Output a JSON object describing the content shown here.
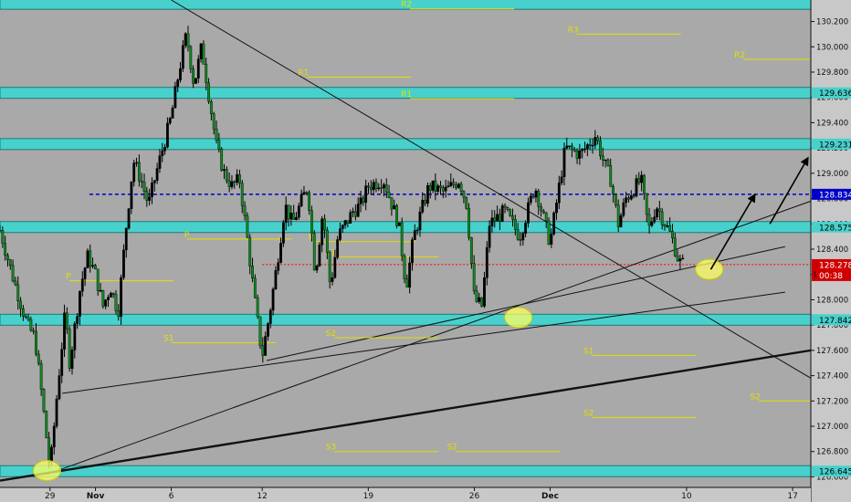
{
  "chart_data": {
    "type": "candlestick",
    "y_axis": {
      "range": [
        126.56,
        130.37
      ],
      "tick_labels": [
        "130.200",
        "130.000",
        "129.800",
        "129.600",
        "129.400",
        "129.200",
        "129.000",
        "128.800",
        "128.600",
        "128.400",
        "128.200",
        "128.000",
        "127.800",
        "127.600",
        "127.400",
        "127.200",
        "127.000",
        "126.800",
        "126.600"
      ],
      "tick_values": [
        130.2,
        130.0,
        129.8,
        129.6,
        129.4,
        129.2,
        129.0,
        128.8,
        128.6,
        128.4,
        128.2,
        128.0,
        127.8,
        127.6,
        127.4,
        127.2,
        127.0,
        126.8,
        126.6
      ]
    },
    "x_axis": {
      "tick_labels": [
        {
          "label": "29",
          "day": 0
        },
        {
          "label": "Nov",
          "day": 3
        },
        {
          "label": "6",
          "day": 8
        },
        {
          "label": "12",
          "day": 14
        },
        {
          "label": "19",
          "day": 21
        },
        {
          "label": "26",
          "day": 28
        },
        {
          "label": "Dec",
          "day": 33
        },
        {
          "label": "10",
          "day": 42
        },
        {
          "label": "17",
          "day": 49
        }
      ],
      "start_date": "Oct 29",
      "days_visible": [
        -3.3,
        50.2
      ]
    },
    "horizontal_zones": [
      {
        "label": "130.200",
        "value": 130.34,
        "flagged": false
      },
      {
        "label": "129.636",
        "value": 129.636,
        "flagged": true
      },
      {
        "label": "129.231",
        "value": 129.231,
        "flagged": true
      },
      {
        "label": "128.575",
        "value": 128.575,
        "flagged": true
      },
      {
        "label": "127.842",
        "value": 127.842,
        "flagged": true
      },
      {
        "label": "126.645",
        "value": 126.645,
        "flagged": true
      }
    ],
    "current_price": {
      "label": "128.278",
      "value": 128.278,
      "countdown": "00:38"
    },
    "dashed_level": {
      "label": "128.834",
      "value": 128.834
    },
    "axis_extra_label": {
      "text": "1",
      "value": 128.2
    },
    "price_path": [
      [
        -3.3,
        128.55
      ],
      [
        -2.5,
        128.2
      ],
      [
        -2,
        128.0
      ],
      [
        -1.5,
        127.8
      ],
      [
        -1,
        127.7
      ],
      [
        -0.5,
        127.2
      ],
      [
        0,
        126.65
      ],
      [
        0.5,
        127.3
      ],
      [
        1,
        127.9
      ],
      [
        1.3,
        127.5
      ],
      [
        2,
        128.1
      ],
      [
        2.5,
        128.35
      ],
      [
        3,
        128.2
      ],
      [
        3.5,
        127.95
      ],
      [
        4,
        128.1
      ],
      [
        4.5,
        127.9
      ],
      [
        5,
        128.55
      ],
      [
        5.5,
        129.1
      ],
      [
        6,
        128.95
      ],
      [
        6.5,
        128.75
      ],
      [
        7,
        129.0
      ],
      [
        8,
        129.45
      ],
      [
        8.5,
        129.8
      ],
      [
        9,
        130.1
      ],
      [
        9.5,
        129.7
      ],
      [
        10,
        130.0
      ],
      [
        10.5,
        129.6
      ],
      [
        11,
        129.2
      ],
      [
        11.5,
        129.0
      ],
      [
        12,
        128.9
      ],
      [
        12.5,
        128.95
      ],
      [
        13,
        128.5
      ],
      [
        13.5,
        128.0
      ],
      [
        14,
        127.55
      ],
      [
        14.5,
        127.9
      ],
      [
        15,
        128.3
      ],
      [
        15.5,
        128.75
      ],
      [
        16,
        128.6
      ],
      [
        17,
        128.9
      ],
      [
        17.5,
        128.2
      ],
      [
        18,
        128.7
      ],
      [
        18.5,
        128.1
      ],
      [
        19,
        128.5
      ],
      [
        20,
        128.7
      ],
      [
        20.5,
        128.75
      ],
      [
        21,
        128.9
      ],
      [
        22,
        128.95
      ],
      [
        23,
        128.6
      ],
      [
        23.5,
        128.1
      ],
      [
        24,
        128.5
      ],
      [
        25,
        128.9
      ],
      [
        26,
        128.85
      ],
      [
        27,
        128.95
      ],
      [
        27.5,
        128.75
      ],
      [
        28,
        128.0
      ],
      [
        28.5,
        127.95
      ],
      [
        29,
        128.6
      ],
      [
        30,
        128.7
      ],
      [
        31,
        128.5
      ],
      [
        32,
        128.9
      ],
      [
        33,
        128.45
      ],
      [
        34,
        129.2
      ],
      [
        35,
        129.15
      ],
      [
        36,
        129.3
      ],
      [
        36.5,
        129.1
      ],
      [
        37,
        128.95
      ],
      [
        37.5,
        128.6
      ],
      [
        38,
        128.8
      ],
      [
        39,
        128.95
      ],
      [
        39.5,
        128.55
      ],
      [
        40,
        128.75
      ],
      [
        41,
        128.5
      ],
      [
        41.5,
        128.3
      ],
      [
        41.8,
        128.28
      ]
    ],
    "pivot_labels": [
      {
        "text": "R2",
        "day": 24,
        "value": 130.3
      },
      {
        "text": "R3",
        "day": 35,
        "value": 130.1
      },
      {
        "text": "R2",
        "day": 46,
        "value": 129.9
      },
      {
        "text": "R1",
        "day": 17.2,
        "value": 129.76
      },
      {
        "text": "R1",
        "day": 24,
        "value": 129.59
      },
      {
        "text": "P",
        "day": 17.5,
        "value": 128.46
      },
      {
        "text": "P",
        "day": 9.3,
        "value": 128.48
      },
      {
        "text": "P",
        "day": 1.5,
        "value": 128.15
      },
      {
        "text": "S1",
        "day": 19,
        "value": 128.34
      },
      {
        "text": "S1",
        "day": 8.3,
        "value": 127.66
      },
      {
        "text": "S2",
        "day": 19,
        "value": 127.7
      },
      {
        "text": "S1",
        "day": 36,
        "value": 127.56
      },
      {
        "text": "S2",
        "day": 36,
        "value": 127.07
      },
      {
        "text": "S2",
        "day": 47,
        "value": 127.2
      },
      {
        "text": "S3",
        "day": 19,
        "value": 126.8
      },
      {
        "text": "S2",
        "day": 27,
        "value": 126.8
      }
    ],
    "circled_points": [
      {
        "day": -0.2,
        "value": 126.65
      },
      {
        "day": 30.9,
        "value": 127.86
      },
      {
        "day": 43.5,
        "value": 128.24
      }
    ],
    "grid": false,
    "legend": "none"
  },
  "colors": {
    "background": "#a9a9a9",
    "zone_fill": "#48d1cc",
    "candle_up": "#000000",
    "pivot_line": "#e0e000",
    "dashed_line": "#0000c8",
    "current_price_line": "#ff0000",
    "highlight_circle": "#ffff66"
  }
}
